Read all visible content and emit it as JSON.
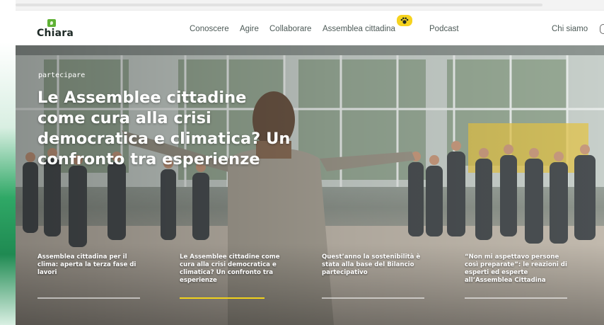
{
  "brand": {
    "logo_text": "Chiara",
    "accent_color": "#5fb135",
    "badge_color": "#f6d31f"
  },
  "nav": {
    "items": [
      {
        "label": "Conoscere"
      },
      {
        "label": "Agire"
      },
      {
        "label": "Collaborare"
      },
      {
        "label": "Assemblea cittadina"
      },
      {
        "label": "Podcast"
      },
      {
        "label": "Chi siamo"
      }
    ],
    "badge_icon": "paw-icon"
  },
  "hero": {
    "category": "partecipare",
    "title": "Le Assemblee cittadine come cura alla crisi democratica e climatica? Un confronto tra esperienze"
  },
  "articles": [
    {
      "title": "Assemblea cittadina per il clima: aperta la terza fase di lavori",
      "active": false
    },
    {
      "title": "Le Assemblee cittadine come cura alla crisi democratica e climatica? Un confronto tra esperienze",
      "active": true
    },
    {
      "title": "Quest’anno la sostenibilità è stata alla base del Bilancio partecipativo",
      "active": false
    },
    {
      "title": "“Non mi aspettavo persone così preparate”: le reazioni di esperti ed esperte all’Assemblea Cittadina",
      "active": false
    }
  ]
}
